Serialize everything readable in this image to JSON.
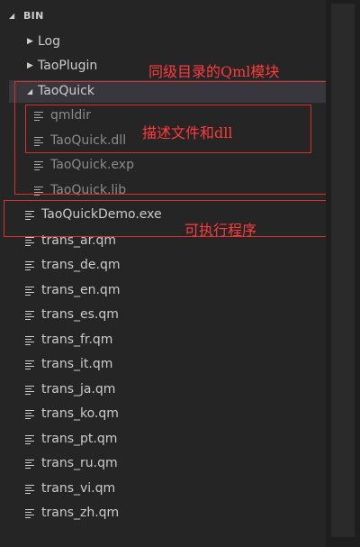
{
  "explorer": {
    "section_title": "BIN",
    "items": [
      {
        "label": "Log",
        "kind": "folder",
        "state": "collapsed"
      },
      {
        "label": "TaoPlugin",
        "kind": "folder",
        "state": "collapsed"
      },
      {
        "label": "TaoQuick",
        "kind": "folder",
        "state": "expanded"
      },
      {
        "label": "qmldir",
        "kind": "file"
      },
      {
        "label": "TaoQuick.dll",
        "kind": "file"
      },
      {
        "label": "TaoQuick.exp",
        "kind": "file"
      },
      {
        "label": "TaoQuick.lib",
        "kind": "file"
      },
      {
        "label": "TaoQuickDemo.exe",
        "kind": "file"
      },
      {
        "label": "trans_ar.qm",
        "kind": "file"
      },
      {
        "label": "trans_de.qm",
        "kind": "file"
      },
      {
        "label": "trans_en.qm",
        "kind": "file"
      },
      {
        "label": "trans_es.qm",
        "kind": "file"
      },
      {
        "label": "trans_fr.qm",
        "kind": "file"
      },
      {
        "label": "trans_it.qm",
        "kind": "file"
      },
      {
        "label": "trans_ja.qm",
        "kind": "file"
      },
      {
        "label": "trans_ko.qm",
        "kind": "file"
      },
      {
        "label": "trans_pt.qm",
        "kind": "file"
      },
      {
        "label": "trans_ru.qm",
        "kind": "file"
      },
      {
        "label": "trans_vi.qm",
        "kind": "file"
      },
      {
        "label": "trans_zh.qm",
        "kind": "file"
      }
    ]
  },
  "annotations": {
    "qml_module": "同级目录的Qml模块",
    "descriptor_dll": "描述文件和dll",
    "executable": "可执行程序"
  },
  "colors": {
    "background": "#252526",
    "text": "#cccccc",
    "annotation": "#ff3b3b",
    "selection": "#37373d"
  }
}
